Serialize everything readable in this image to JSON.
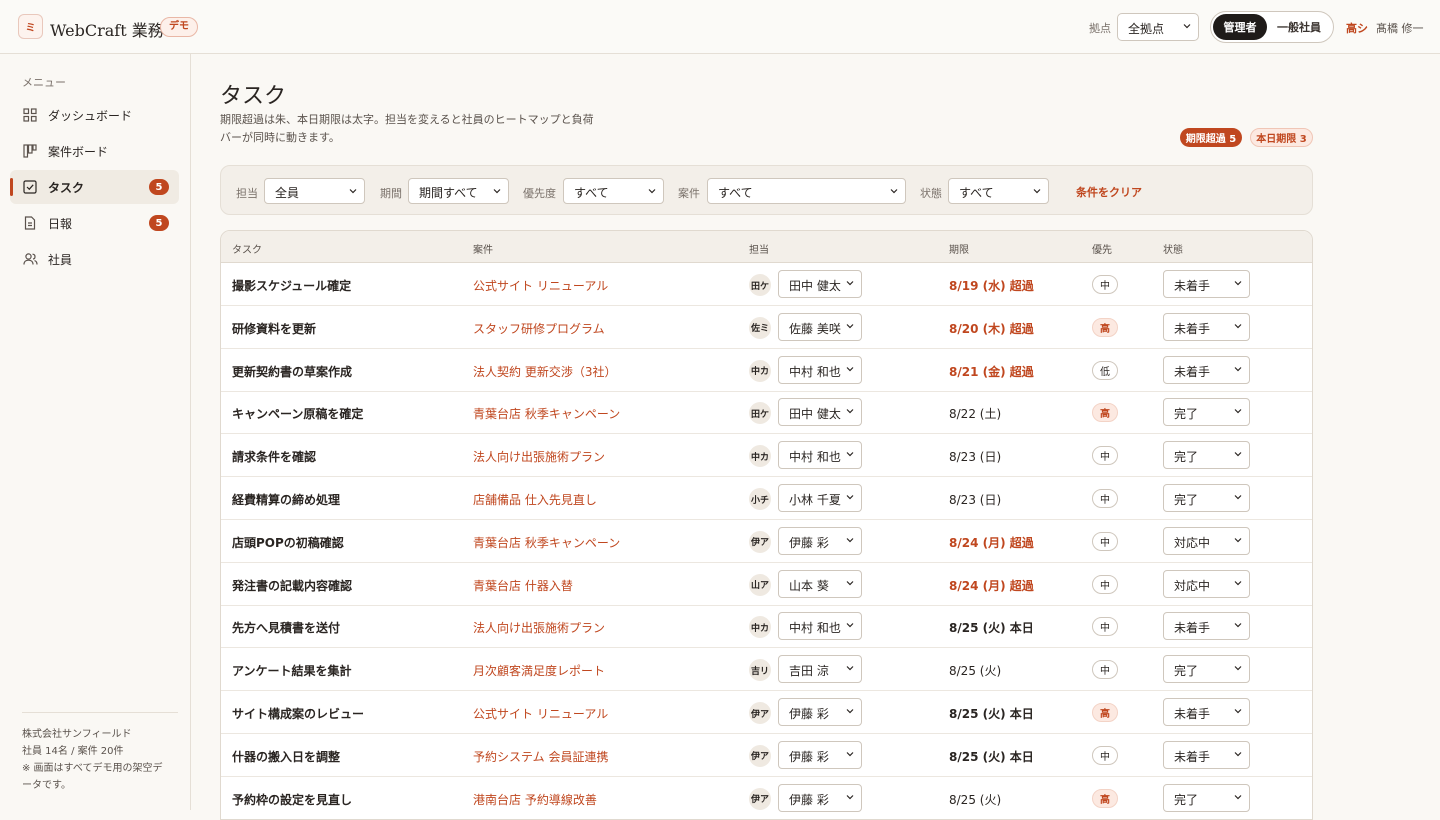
{
  "header": {
    "logo_mark": "ミ",
    "app_title": "WebCraft 業務",
    "demo_badge": "デモ",
    "location_label": "拠点",
    "location_value": "全拠点",
    "roles": {
      "admin": "管理者",
      "staff": "一般社員",
      "active": "admin"
    },
    "user_initial": "高シ",
    "user_name": "髙橋 修一"
  },
  "sidebar": {
    "menu_label": "メニュー",
    "items": [
      {
        "label": "ダッシュボード",
        "icon": "grid-icon",
        "count": null,
        "active": false
      },
      {
        "label": "案件ボード",
        "icon": "kanban-icon",
        "count": null,
        "active": false
      },
      {
        "label": "タスク",
        "icon": "checkbox-icon",
        "count": "5",
        "active": true
      },
      {
        "label": "日報",
        "icon": "document-icon",
        "count": "5",
        "active": false
      },
      {
        "label": "社員",
        "icon": "people-icon",
        "count": null,
        "active": false
      }
    ],
    "footer": {
      "company": "株式会社サンフィールド",
      "stats": "社員 14名 / 案件 20件",
      "note": "※ 画面はすべてデモ用の架空データです。"
    }
  },
  "main": {
    "title": "タスク",
    "description": "期限超過は朱、本日期限は太字。担当を変えると社員のヒートマップと負荷バーが同時に動きます。",
    "pills": {
      "overdue": "期限超過 5",
      "today": "本日期限 3"
    },
    "filters": {
      "assignee_label": "担当",
      "assignee_value": "全員",
      "period_label": "期間",
      "period_value": "期間すべて",
      "priority_label": "優先度",
      "priority_value": "すべて",
      "project_label": "案件",
      "project_value": "すべて",
      "status_label": "状態",
      "status_value": "すべて",
      "clear_label": "条件をクリア"
    },
    "columns": {
      "task": "タスク",
      "project": "案件",
      "assignee": "担当",
      "due": "期限",
      "priority": "優先",
      "status": "状態"
    },
    "rows": [
      {
        "task": "撮影スケジュール確定",
        "project": "公式サイト リニューアル",
        "avatar": "田ケ",
        "assignee": "田中 健太",
        "due": "8/19 (水) 超過",
        "due_state": "overdue",
        "priority": "中",
        "priority_level": "mid",
        "status": "未着手"
      },
      {
        "task": "研修資料を更新",
        "project": "スタッフ研修プログラム",
        "avatar": "佐ミ",
        "assignee": "佐藤 美咲",
        "due": "8/20 (木) 超過",
        "due_state": "overdue",
        "priority": "高",
        "priority_level": "high",
        "status": "未着手"
      },
      {
        "task": "更新契約書の草案作成",
        "project": "法人契約 更新交渉（3社）",
        "avatar": "中カ",
        "assignee": "中村 和也",
        "due": "8/21 (金) 超過",
        "due_state": "overdue",
        "priority": "低",
        "priority_level": "low",
        "status": "未着手"
      },
      {
        "task": "キャンペーン原稿を確定",
        "project": "青葉台店 秋季キャンペーン",
        "avatar": "田ケ",
        "assignee": "田中 健太",
        "due": "8/22 (土)",
        "due_state": "normal",
        "priority": "高",
        "priority_level": "high",
        "status": "完了"
      },
      {
        "task": "請求条件を確認",
        "project": "法人向け出張施術プラン",
        "avatar": "中カ",
        "assignee": "中村 和也",
        "due": "8/23 (日)",
        "due_state": "normal",
        "priority": "中",
        "priority_level": "mid",
        "status": "完了"
      },
      {
        "task": "経費精算の締め処理",
        "project": "店舗備品 仕入先見直し",
        "avatar": "小チ",
        "assignee": "小林 千夏",
        "due": "8/23 (日)",
        "due_state": "normal",
        "priority": "中",
        "priority_level": "mid",
        "status": "完了"
      },
      {
        "task": "店頭POPの初稿確認",
        "project": "青葉台店 秋季キャンペーン",
        "avatar": "伊ア",
        "assignee": "伊藤 彩",
        "due": "8/24 (月) 超過",
        "due_state": "overdue",
        "priority": "中",
        "priority_level": "mid",
        "status": "対応中"
      },
      {
        "task": "発注書の記載内容確認",
        "project": "青葉台店 什器入替",
        "avatar": "山ア",
        "assignee": "山本 葵",
        "due": "8/24 (月) 超過",
        "due_state": "overdue",
        "priority": "中",
        "priority_level": "mid",
        "status": "対応中"
      },
      {
        "task": "先方へ見積書を送付",
        "project": "法人向け出張施術プラン",
        "avatar": "中カ",
        "assignee": "中村 和也",
        "due": "8/25 (火) 本日",
        "due_state": "today",
        "priority": "中",
        "priority_level": "mid",
        "status": "未着手"
      },
      {
        "task": "アンケート結果を集計",
        "project": "月次顧客満足度レポート",
        "avatar": "吉リ",
        "assignee": "吉田 涼",
        "due": "8/25 (火)",
        "due_state": "normal",
        "priority": "中",
        "priority_level": "mid",
        "status": "完了"
      },
      {
        "task": "サイト構成案のレビュー",
        "project": "公式サイト リニューアル",
        "avatar": "伊ア",
        "assignee": "伊藤 彩",
        "due": "8/25 (火) 本日",
        "due_state": "today",
        "priority": "高",
        "priority_level": "high",
        "status": "未着手"
      },
      {
        "task": "什器の搬入日を調整",
        "project": "予約システム 会員証連携",
        "avatar": "伊ア",
        "assignee": "伊藤 彩",
        "due": "8/25 (火) 本日",
        "due_state": "today",
        "priority": "中",
        "priority_level": "mid",
        "status": "未着手"
      },
      {
        "task": "予約枠の設定を見直し",
        "project": "港南台店 予約導線改善",
        "avatar": "伊ア",
        "assignee": "伊藤 彩",
        "due": "8/25 (火)",
        "due_state": "normal",
        "priority": "高",
        "priority_level": "high",
        "status": "完了"
      }
    ]
  },
  "colors": {
    "accent": "#c0471f",
    "background": "#faf8f4",
    "dark": "#1f1b19"
  }
}
